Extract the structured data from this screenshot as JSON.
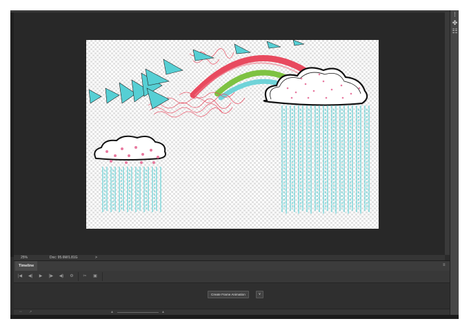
{
  "status_bar": {
    "zoom": "25%",
    "doc_info": "Doc: 95.6M/1.81G",
    "expand_arrow": ">"
  },
  "timeline": {
    "tab_label": "Timeline",
    "create_button_label": "Create Frame Animation",
    "dropdown_glyph": "∨"
  },
  "controls": [
    "|◀",
    "◀|",
    "▶",
    "|▶",
    "◀)",
    "⚙",
    "✂",
    "▣"
  ],
  "icons": {
    "panel_menu": "≡",
    "right_panel": [
      "⁞",
      "✤",
      "☷"
    ]
  },
  "colors": {
    "rain": "#56cfd4",
    "rainbow_red": "#e84a5f",
    "rainbow_green": "#7ec242",
    "rainbow_teal": "#6fd3d8",
    "dots": "#e87aa0"
  }
}
